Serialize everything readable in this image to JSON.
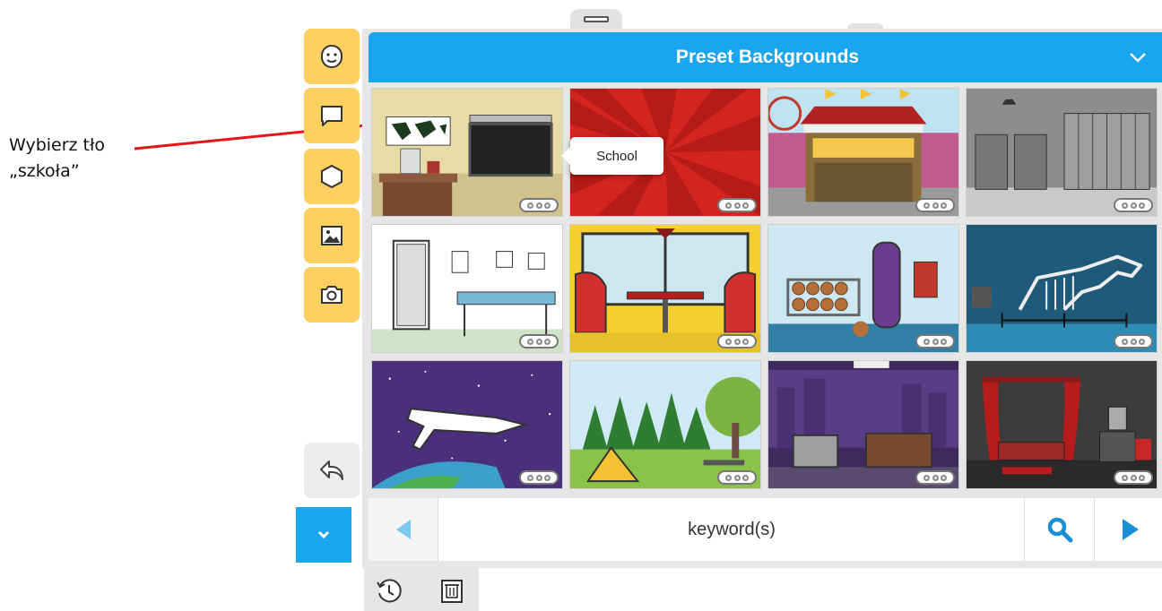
{
  "annotation": {
    "line1": "Wybierz tło",
    "line2": "„szkoła”"
  },
  "panel": {
    "title": "Preset Backgrounds"
  },
  "tooltip": {
    "text": "School"
  },
  "search": {
    "placeholder": "keyword(s)"
  },
  "toolbar": {
    "tools": [
      "character-icon",
      "speech-bubble-icon",
      "shape-icon",
      "image-icon",
      "camera-icon"
    ],
    "undo_icon": "undo-icon",
    "collapse_icon": "chevron-down-icon"
  },
  "tiles": [
    {
      "scene": "classroom"
    },
    {
      "scene": "red-rays"
    },
    {
      "scene": "carnival-stand"
    },
    {
      "scene": "hallway-lockers"
    },
    {
      "scene": "doctor-office"
    },
    {
      "scene": "diner-booth"
    },
    {
      "scene": "gym"
    },
    {
      "scene": "museum-dinosaur"
    },
    {
      "scene": "space-shuttle"
    },
    {
      "scene": "forest-camp"
    },
    {
      "scene": "night-office"
    },
    {
      "scene": "theater-bedroom"
    }
  ],
  "colors": {
    "accent": "#1aa6ee",
    "tool_yellow": "#fdd060",
    "annotation_arrow": "#e8141b"
  }
}
